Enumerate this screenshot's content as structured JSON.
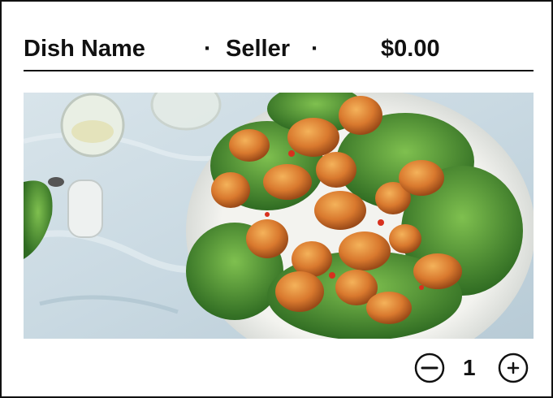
{
  "card": {
    "dish_name": "Dish Name",
    "separator_1": "·",
    "seller": "Seller",
    "separator_2": "·",
    "price": "$0.00"
  },
  "photo": {
    "subject": "shrimp salad on lettuce in a white bowl"
  },
  "quantity": {
    "value": "1",
    "decrement_icon": "minus-circle-icon",
    "increment_icon": "plus-circle-icon"
  },
  "colors": {
    "border": "#111111",
    "background": "#ffffff",
    "text": "#111111"
  }
}
